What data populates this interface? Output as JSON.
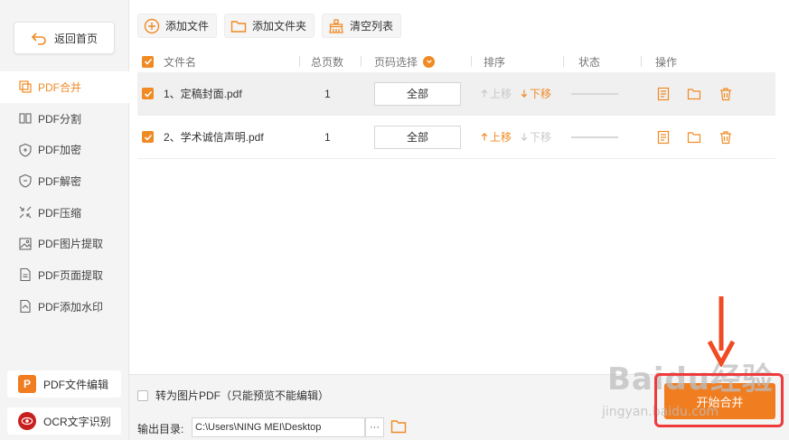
{
  "sidebar": {
    "back_label": "返回首页",
    "items": [
      {
        "label": "PDF合并",
        "icon": "merge-icon",
        "active": true
      },
      {
        "label": "PDF分割",
        "icon": "split-icon"
      },
      {
        "label": "PDF加密",
        "icon": "encrypt-icon"
      },
      {
        "label": "PDF解密",
        "icon": "decrypt-icon"
      },
      {
        "label": "PDF压缩",
        "icon": "compress-icon"
      },
      {
        "label": "PDF图片提取",
        "icon": "image-extract-icon"
      },
      {
        "label": "PDF页面提取",
        "icon": "page-extract-icon"
      },
      {
        "label": "PDF添加水印",
        "icon": "watermark-icon"
      }
    ],
    "pdf_edit_label": "PDF文件编辑",
    "ocr_label": "OCR文字识别"
  },
  "toolbar": {
    "add_file": "添加文件",
    "add_folder": "添加文件夹",
    "clear_list": "清空列表"
  },
  "table": {
    "headers": {
      "filename": "文件名",
      "pages": "总页数",
      "page_select": "页码选择",
      "sort": "排序",
      "status": "状态",
      "actions": "操作"
    },
    "rows": [
      {
        "name": "1、定稿封面.pdf",
        "pages": "1",
        "range": "全部",
        "up": "上移",
        "down": "下移"
      },
      {
        "name": "2、学术诚信声明.pdf",
        "pages": "1",
        "range": "全部",
        "up": "上移",
        "down": "下移"
      }
    ]
  },
  "bottom": {
    "to_image_pdf": "转为图片PDF（只能预览不能编辑）",
    "output_label": "输出目录:",
    "output_path": "C:\\Users\\NING MEI\\Desktop",
    "more": "···",
    "start_label": "开始合并"
  },
  "watermark": {
    "text": "Baidu经验",
    "url": "jingyan.baidu.com"
  },
  "colors": {
    "accent": "#f08a24",
    "highlight": "#ee3a3a"
  }
}
